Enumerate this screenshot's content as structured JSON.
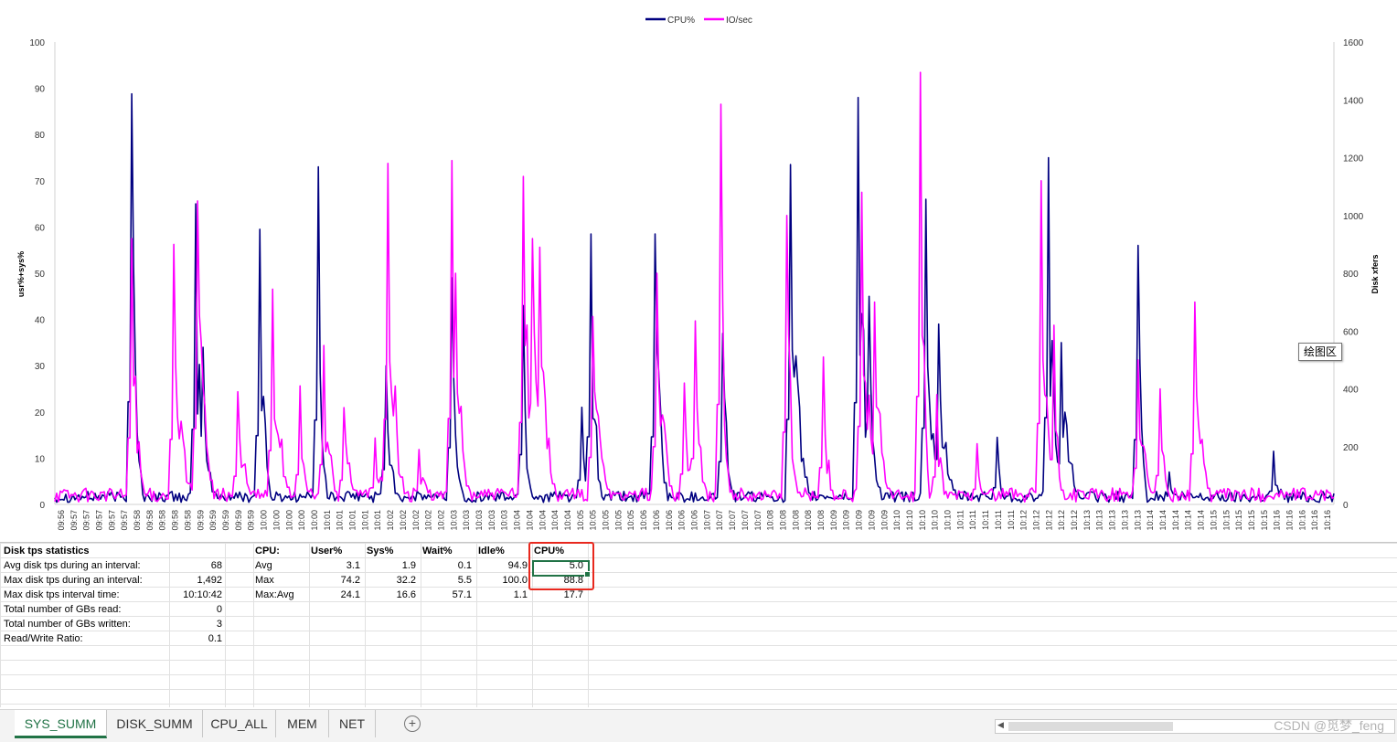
{
  "chart_data": {
    "type": "line",
    "legend": [
      "CPU%",
      "IO/sec"
    ],
    "legend_position": "top-center",
    "ylabel_left": "usr%+sys%",
    "ylabel_right": "Disk xfers",
    "ylim_left": [
      0,
      100
    ],
    "ylim_right": [
      0,
      1600
    ],
    "yticks_left": [
      "100",
      "90",
      "80",
      "70",
      "60",
      "50",
      "40",
      "30",
      "20",
      "10",
      "0"
    ],
    "yticks_right": [
      "1600",
      "1400",
      "1200",
      "1000",
      "800",
      "600",
      "400",
      "200",
      "0"
    ],
    "x_ticks": [
      "09:56",
      "09:57",
      "09:57",
      "09:57",
      "09:57",
      "09:57",
      "09:58",
      "09:58",
      "09:58",
      "09:58",
      "09:58",
      "09:59",
      "09:59",
      "09:59",
      "09:59",
      "09:59",
      "10:00",
      "10:00",
      "10:00",
      "10:00",
      "10:00",
      "10:01",
      "10:01",
      "10:01",
      "10:01",
      "10:01",
      "10:02",
      "10:02",
      "10:02",
      "10:02",
      "10:02",
      "10:03",
      "10:03",
      "10:03",
      "10:03",
      "10:03",
      "10:04",
      "10:04",
      "10:04",
      "10:04",
      "10:04",
      "10:05",
      "10:05",
      "10:05",
      "10:05",
      "10:05",
      "10:06",
      "10:06",
      "10:06",
      "10:06",
      "10:06",
      "10:07",
      "10:07",
      "10:07",
      "10:07",
      "10:07",
      "10:08",
      "10:08",
      "10:08",
      "10:08",
      "10:08",
      "10:09",
      "10:09",
      "10:09",
      "10:09",
      "10:09",
      "10:10",
      "10:10",
      "10:10",
      "10:10",
      "10:10",
      "10:11",
      "10:11",
      "10:11",
      "10:11",
      "10:11",
      "10:12",
      "10:12",
      "10:12",
      "10:12",
      "10:12",
      "10:13",
      "10:13",
      "10:13",
      "10:13",
      "10:13",
      "10:14",
      "10:14",
      "10:14",
      "10:14",
      "10:14",
      "10:15",
      "10:15",
      "10:15",
      "10:15",
      "10:15",
      "10:16",
      "10:16",
      "10:16",
      "10:16",
      "10:16"
    ],
    "series": [
      {
        "name": "CPU%",
        "color": "#000080",
        "axis": "left",
        "peaks": [
          [
            0.06,
            88.8
          ],
          [
            0.11,
            65
          ],
          [
            0.115,
            34
          ],
          [
            0.16,
            59.5
          ],
          [
            0.205,
            73
          ],
          [
            0.258,
            30
          ],
          [
            0.31,
            49
          ],
          [
            0.365,
            43
          ],
          [
            0.412,
            21
          ],
          [
            0.418,
            58.5
          ],
          [
            0.468,
            58.5
          ],
          [
            0.522,
            37
          ],
          [
            0.575,
            73.5
          ],
          [
            0.627,
            88
          ],
          [
            0.635,
            45
          ],
          [
            0.68,
            66
          ],
          [
            0.69,
            39
          ],
          [
            0.735,
            14.5
          ],
          [
            0.775,
            75
          ],
          [
            0.785,
            35
          ],
          [
            0.845,
            56
          ],
          [
            0.87,
            7
          ],
          [
            0.952,
            11.5
          ]
        ],
        "baseline": 1.5
      },
      {
        "name": "IO/sec",
        "color": "#ff00ff",
        "axis": "right",
        "peaks": [
          [
            0.06,
            920
          ],
          [
            0.093,
            900
          ],
          [
            0.112,
            1050
          ],
          [
            0.143,
            390
          ],
          [
            0.17,
            745
          ],
          [
            0.192,
            410
          ],
          [
            0.21,
            550
          ],
          [
            0.225,
            335
          ],
          [
            0.25,
            230
          ],
          [
            0.26,
            1180
          ],
          [
            0.285,
            190
          ],
          [
            0.313,
            800
          ],
          [
            0.31,
            1190
          ],
          [
            0.365,
            1135
          ],
          [
            0.373,
            920
          ],
          [
            0.378,
            890
          ],
          [
            0.42,
            650
          ],
          [
            0.47,
            800
          ],
          [
            0.492,
            420
          ],
          [
            0.5,
            635
          ],
          [
            0.52,
            1385
          ],
          [
            0.572,
            1000
          ],
          [
            0.6,
            510
          ],
          [
            0.63,
            1080
          ],
          [
            0.64,
            700
          ],
          [
            0.676,
            1495
          ],
          [
            0.688,
            380
          ],
          [
            0.72,
            210
          ],
          [
            0.77,
            1120
          ],
          [
            0.78,
            620
          ],
          [
            0.845,
            500
          ],
          [
            0.863,
            400
          ],
          [
            0.89,
            700
          ]
        ],
        "baseline": 30
      }
    ]
  },
  "tooltip": "绘图区",
  "disk_stats": {
    "title": "Disk tps statistics",
    "rows": [
      {
        "label": "Avg disk tps during an interval:",
        "value": "68"
      },
      {
        "label": "Max disk tps during an interval:",
        "value": "1,492"
      },
      {
        "label": "Max disk tps interval time:",
        "value": "10:10:42"
      },
      {
        "label": "Total number of GBs read:",
        "value": "0"
      },
      {
        "label": "Total number of GBs written:",
        "value": "3"
      },
      {
        "label": "Read/Write Ratio:",
        "value": "0.1"
      }
    ]
  },
  "cpu_table": {
    "headers": [
      "CPU:",
      "User%",
      "Sys%",
      "Wait%",
      "Idle%",
      "CPU%"
    ],
    "rows": [
      [
        "Avg",
        "3.1",
        "1.9",
        "0.1",
        "94.9",
        "5.0"
      ],
      [
        "Max",
        "74.2",
        "32.2",
        "5.5",
        "100.0",
        "88.8"
      ],
      [
        "Max:Avg",
        "24.1",
        "16.6",
        "57.1",
        "1.1",
        "17.7"
      ]
    ]
  },
  "tabs": [
    {
      "label": "SYS_SUMM",
      "active": true
    },
    {
      "label": "DISK_SUMM",
      "active": false
    },
    {
      "label": "CPU_ALL",
      "active": false
    },
    {
      "label": "MEM",
      "active": false
    },
    {
      "label": "NET",
      "active": false
    }
  ],
  "add_sheet_label": "+",
  "watermark": "CSDN @觅梦_feng"
}
